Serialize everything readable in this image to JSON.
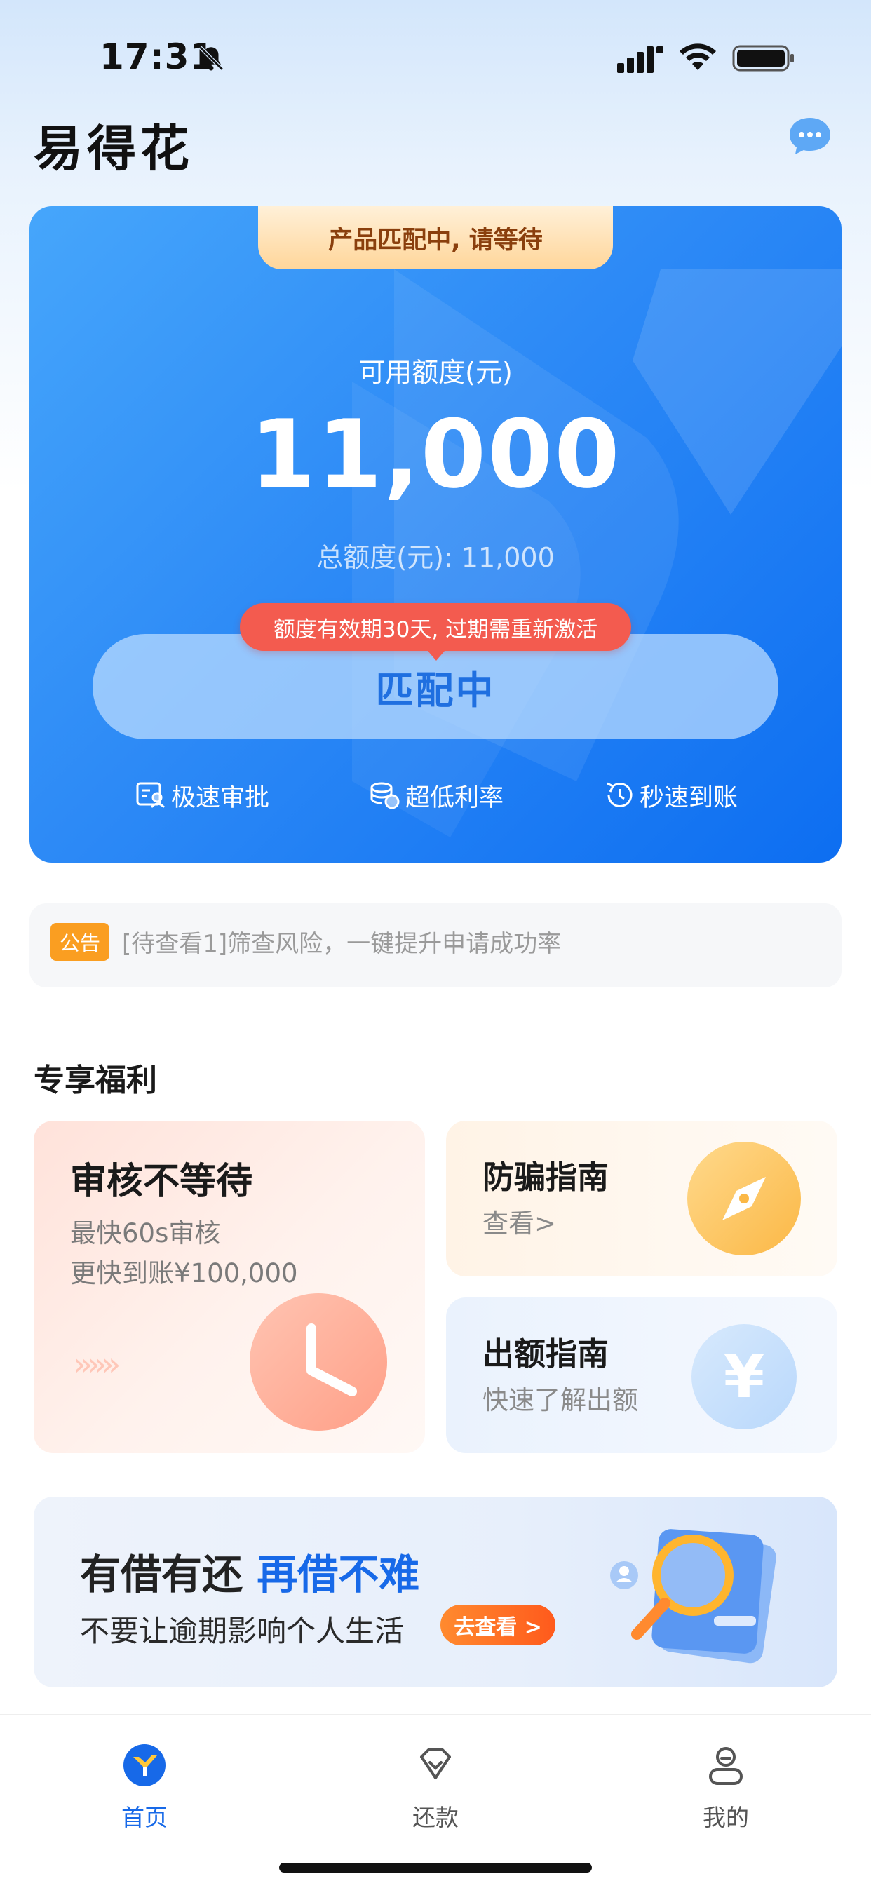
{
  "status_bar": {
    "time": "17:31"
  },
  "header": {
    "title": "易得花"
  },
  "credit_card": {
    "status_ribbon": "产品匹配中, 请等待",
    "available_label": "可用额度(元)",
    "available_amount": "11,000",
    "total_label": "总额度(元): 11,000",
    "expiry_tip": "额度有效期30天, 过期需重新激活",
    "match_button": "匹配中",
    "features": [
      {
        "label": "极速审批",
        "icon": "approval-icon"
      },
      {
        "label": "超低利率",
        "icon": "coins-icon"
      },
      {
        "label": "秒速到账",
        "icon": "clock-refresh-icon"
      }
    ]
  },
  "notice": {
    "badge": "公告",
    "text": "[待查看1]筛查风险，一键提升申请成功率"
  },
  "benefits": {
    "section_title": "专享福利",
    "main": {
      "title": "审核不等待",
      "line1": "最快60s审核",
      "line2": "更快到账¥100,000",
      "arrows": "»»»"
    },
    "anti_fraud": {
      "title": "防骗指南",
      "subtitle": "查看>"
    },
    "quota_guide": {
      "title": "出额指南",
      "subtitle": "快速了解出额",
      "icon_glyph": "¥"
    }
  },
  "banner": {
    "title_part1": "有借有还 ",
    "title_highlight": "再借不难",
    "subtitle": "不要让逾期影响个人生活",
    "button": "去查看 >"
  },
  "tab_bar": {
    "tabs": [
      {
        "label": "首页",
        "active": true
      },
      {
        "label": "还款",
        "active": false
      },
      {
        "label": "我的",
        "active": false
      }
    ]
  },
  "colors": {
    "brand_blue": "#1769e8",
    "card_gradient_start": "#46a6fb",
    "card_gradient_end": "#0d6ef1",
    "tip_red": "#f35b4f",
    "notice_orange": "#fa9e21",
    "cta_orange": "#ff5a1c"
  }
}
